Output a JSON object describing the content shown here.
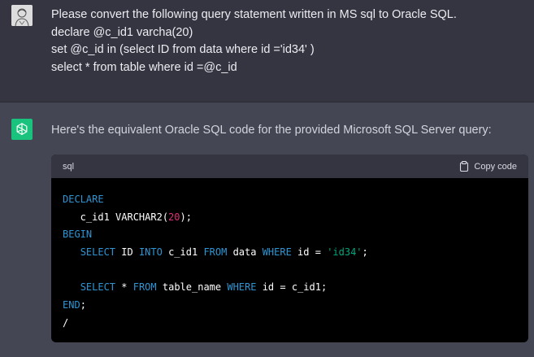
{
  "user_message": {
    "lines": [
      "Please convert the following query statement written in MS sql to Oracle SQL.",
      "declare @c_id1 varcha(20)",
      "set @c_id in (select ID from data where id ='id34' )",
      "select * from table where id =@c_id"
    ]
  },
  "assistant_message": {
    "text": "Here's the equivalent Oracle SQL code for the provided Microsoft SQL Server query:"
  },
  "code_block": {
    "language": "sql",
    "copy_label": "Copy code",
    "tokens": {
      "l1_kw": "DECLARE",
      "l2_a": "   c_id1 VARCHAR2(",
      "l2_num": "20",
      "l2_b": ");",
      "l3_kw": "BEGIN",
      "l4_indent": "   ",
      "l4_select": "SELECT",
      "l4_id": " ID ",
      "l4_into": "INTO",
      "l4_cid": " c_id1 ",
      "l4_from": "FROM",
      "l4_data": " data ",
      "l4_where": "WHERE",
      "l4_cond": " id = ",
      "l4_str": "'id34'",
      "l4_end": ";",
      "l6_indent": "   ",
      "l6_select": "SELECT",
      "l6_star": " * ",
      "l6_from": "FROM",
      "l6_table": " table_name ",
      "l6_where": "WHERE",
      "l6_cond": " id = c_id1;",
      "l7_kw": "END",
      "l7_semi": ";",
      "l8": "/"
    }
  },
  "colors": {
    "keyword": "#2e95d3",
    "number": "#df3079",
    "string": "#00a67d",
    "brand": "#19c37d"
  }
}
